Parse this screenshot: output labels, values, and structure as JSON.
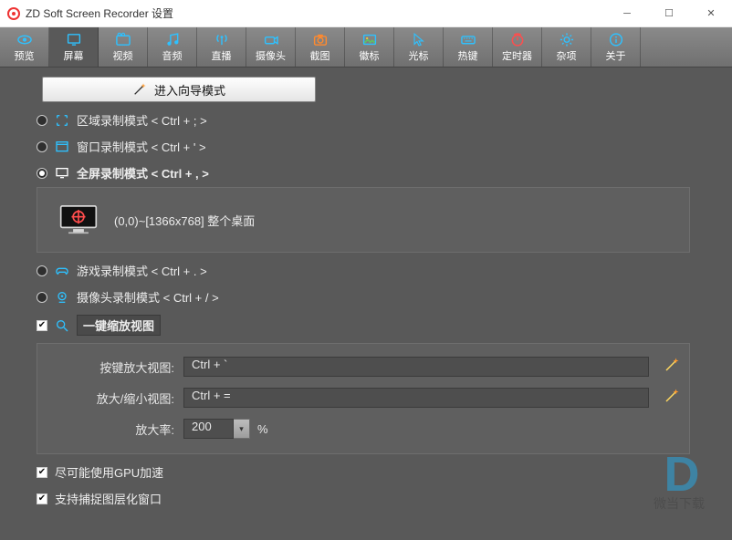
{
  "window": {
    "title": "ZD Soft Screen Recorder 设置"
  },
  "toolbar": [
    {
      "label": "预览"
    },
    {
      "label": "屏幕"
    },
    {
      "label": "视频"
    },
    {
      "label": "音频"
    },
    {
      "label": "直播"
    },
    {
      "label": "摄像头"
    },
    {
      "label": "截图"
    },
    {
      "label": "徽标"
    },
    {
      "label": "光标"
    },
    {
      "label": "热键"
    },
    {
      "label": "定时器"
    },
    {
      "label": "杂项"
    },
    {
      "label": "关于"
    }
  ],
  "active_tab": 1,
  "wizard_button": "进入向导模式",
  "modes": {
    "region": {
      "label": "区域录制模式 < Ctrl + ; >"
    },
    "window": {
      "label": "窗口录制模式 < Ctrl + ' >"
    },
    "fullscreen": {
      "label": "全屏录制模式 < Ctrl + , >"
    },
    "game": {
      "label": "游戏录制模式 < Ctrl + . >"
    },
    "camera": {
      "label": "摄像头录制模式 < Ctrl + / >"
    }
  },
  "fullscreen_desc": "(0,0)~[1366x768] 整个桌面",
  "zoom_section": {
    "title": "一键缩放视图",
    "rows": {
      "zoom_in": {
        "label": "按键放大视图:",
        "value": "Ctrl + `"
      },
      "zoom_both": {
        "label": "放大/缩小视图:",
        "value": "Ctrl + ="
      },
      "ratio": {
        "label": "放大率:",
        "value": "200",
        "unit": "%"
      }
    }
  },
  "footer": {
    "gpu": "尽可能使用GPU加速",
    "layered": "支持捕捉图层化窗口"
  },
  "watermark": "微当下载"
}
